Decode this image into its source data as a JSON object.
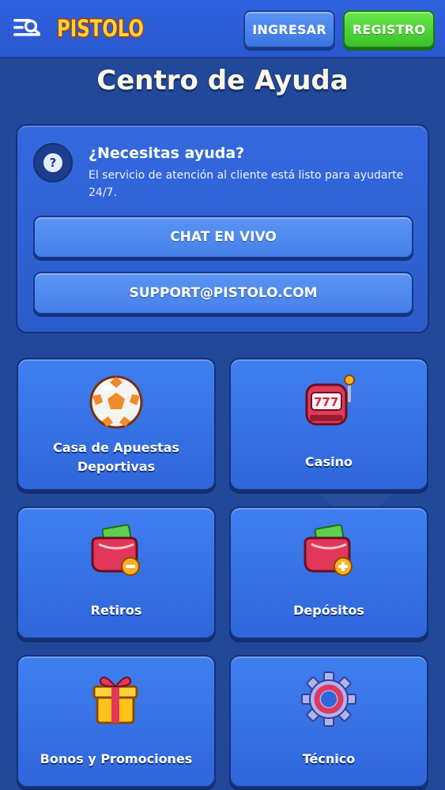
{
  "header": {
    "logo_text": "PISTOLO",
    "login_label": "INGRESAR",
    "register_label": "REGISTRO"
  },
  "page": {
    "title": "Centro de Ayuda"
  },
  "help": {
    "title": "¿Necesitas ayuda?",
    "description": "El servicio de atención al cliente está listo para ayudarte 24/7.",
    "chat_label": "CHAT EN VIVO",
    "email_label": "SUPPORT@PISTOLO.COM"
  },
  "categories": [
    {
      "label": "Casa de Apuestas Deportivas",
      "icon": "soccer-ball-icon"
    },
    {
      "label": "Casino",
      "icon": "slot-machine-icon"
    },
    {
      "label": "Retiros",
      "icon": "wallet-minus-icon"
    },
    {
      "label": "Depósitos",
      "icon": "wallet-plus-icon"
    },
    {
      "label": "Bonos y Promociones",
      "icon": "gift-box-icon"
    },
    {
      "label": "Técnico",
      "icon": "gear-icon"
    }
  ],
  "colors": {
    "background": "#22489a",
    "header": "#2f63e0",
    "register_green": "#4fd43a",
    "card_blue": "#3f7ff0",
    "logo_yellow": "#ffd43a"
  }
}
